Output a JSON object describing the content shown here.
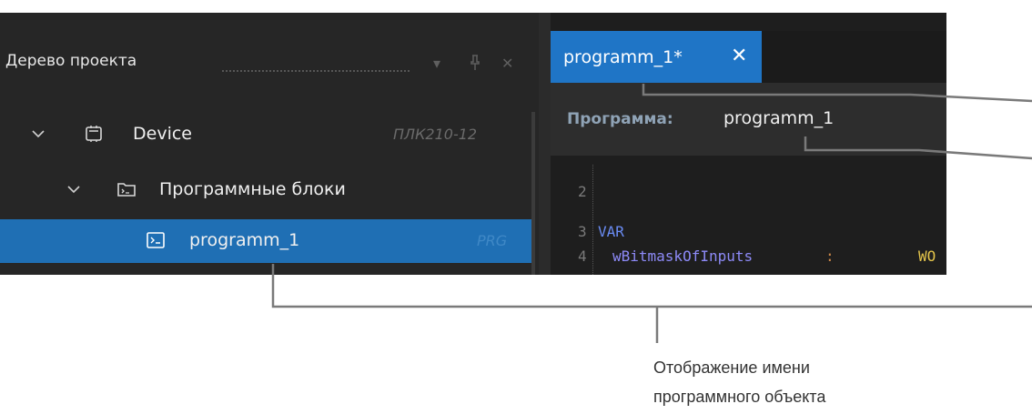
{
  "project_tree": {
    "title": "Дерево проекта",
    "items": [
      {
        "label": "Device",
        "tag": "ПЛК210-12"
      },
      {
        "label": "Программные блоки",
        "tag": ""
      },
      {
        "label": "programm_1",
        "tag": "PRG"
      }
    ]
  },
  "editor": {
    "tab_label": "programm_1*",
    "tab_close": "✕",
    "program_label": "Программа:",
    "program_name": "programm_1",
    "code_lines": [
      {
        "number": "2",
        "keyword": "",
        "identifier": "",
        "colon": "",
        "type": ""
      },
      {
        "number": "3",
        "keyword": "VAR",
        "identifier": "",
        "colon": "",
        "type": ""
      },
      {
        "number": "4",
        "keyword": "",
        "identifier": "wBitmaskOfInputs",
        "colon": ":",
        "type": "WO"
      }
    ]
  },
  "caption": {
    "line1": "Отображение имени",
    "line2": "программного объекта"
  },
  "colors": {
    "selection": "#1f6fb4",
    "tab_active": "#1f75c6",
    "panel_bg": "#262626",
    "editor_bg": "#1e1e1e"
  },
  "icons": [
    "chevron-down-icon",
    "device-icon",
    "folder-icon",
    "program-icon",
    "dropdown-icon",
    "pin-icon",
    "close-icon"
  ]
}
